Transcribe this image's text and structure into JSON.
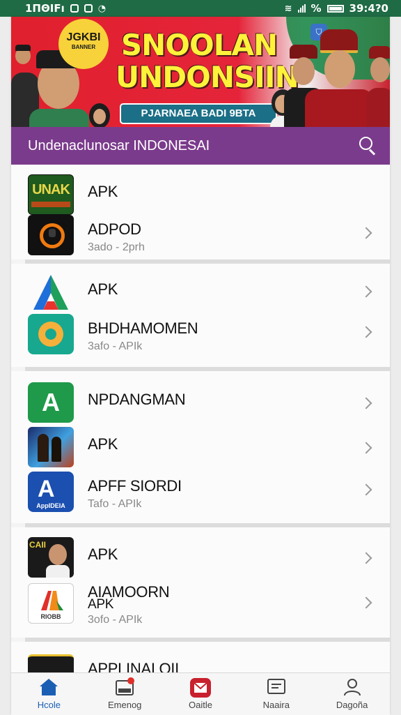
{
  "status_bar": {
    "left_text": "1ΠΘΙFı",
    "time": "39:4?0",
    "battery_label": "%"
  },
  "banner": {
    "badge_line1": "JGKBI",
    "badge_line2": "BANNER",
    "title_line1": "SNOOLAN",
    "title_line2": "UNDONSIIN",
    "subtitle": "PJARNAEA BADI 9BTA",
    "colors": {
      "red": "#e0202d",
      "green": "#1e8a4a",
      "yellow": "#fff23a"
    }
  },
  "header": {
    "title": "Undenaclunosar INDONESAI",
    "icon": "search-icon",
    "color": "#7b3b8c"
  },
  "list": {
    "group1": [
      {
        "name": "APK",
        "sub": "",
        "icon_text": "UNAK"
      },
      {
        "name": "ADPOD",
        "sub": "3ado - 2prh",
        "icon_text": ""
      }
    ],
    "group2": [
      {
        "name": "APK",
        "sub": "",
        "icon_text": "A"
      },
      {
        "name": "BHDHAMOMEN",
        "sub": "3afo - APIk",
        "icon_text": ""
      }
    ],
    "group3": [
      {
        "name": "NPDANGMAN",
        "sub": "",
        "icon_text": "A"
      },
      {
        "name": "APK",
        "sub": "",
        "icon_text": ""
      },
      {
        "name": "APFF SIORDI",
        "sub": "Tafo - APIk",
        "icon_text": "AppIDEIA"
      }
    ],
    "group4": [
      {
        "name": "APK",
        "sub": "",
        "icon_text": "CAII"
      },
      {
        "name": "AIAMOORN",
        "name2": "APK",
        "sub": "3ofo - APIk",
        "icon_text": "RIOBB"
      }
    ],
    "group5": [
      {
        "name": "APPLINAI OII",
        "sub": ""
      }
    ]
  },
  "bottom_nav": [
    {
      "label": "Hcole",
      "icon": "home-icon",
      "active": true
    },
    {
      "label": "Emenog",
      "icon": "inbox-icon",
      "active": false
    },
    {
      "label": "Oaitle",
      "icon": "mail-icon",
      "active": false
    },
    {
      "label": "Naaira",
      "icon": "news-icon",
      "active": false
    },
    {
      "label": "Dagoña",
      "icon": "profile-icon",
      "active": false
    }
  ]
}
